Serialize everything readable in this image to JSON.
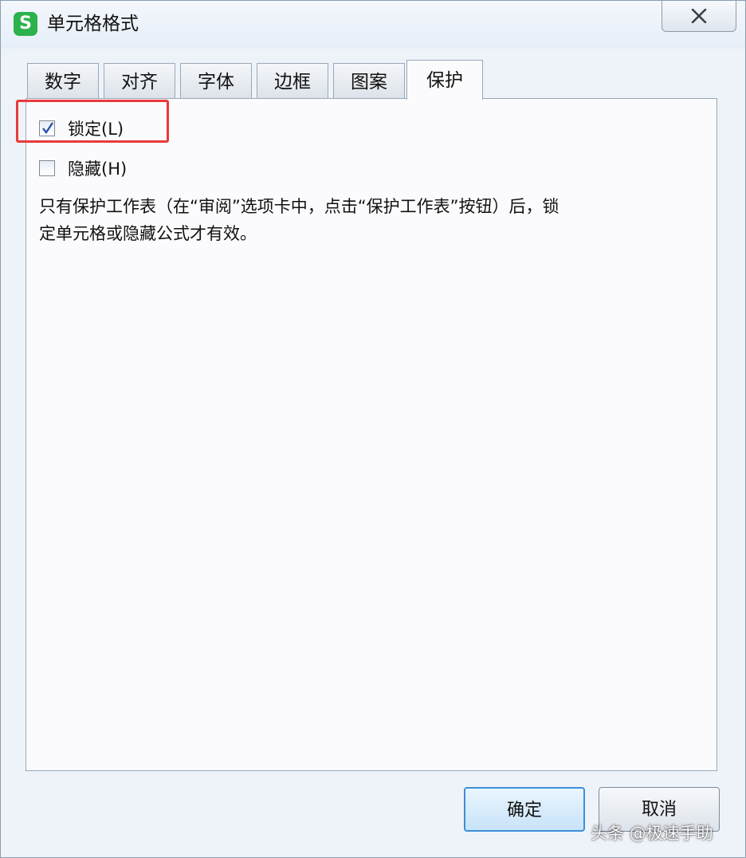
{
  "window": {
    "title": "单元格格式",
    "app_icon": "S",
    "close_icon": "close-icon"
  },
  "tabs": [
    {
      "label": "数字",
      "active": false
    },
    {
      "label": "对齐",
      "active": false
    },
    {
      "label": "字体",
      "active": false
    },
    {
      "label": "边框",
      "active": false
    },
    {
      "label": "图案",
      "active": false
    },
    {
      "label": "保护",
      "active": true
    }
  ],
  "protection": {
    "locked": {
      "label": "锁定(L)",
      "checked": true
    },
    "hidden": {
      "label": "隐藏(H)",
      "checked": false
    },
    "note_line1": "只有保护工作表（在“审阅”选项卡中，点击“保护工作表”按钮）后，锁",
    "note_line2": "定单元格或隐藏公式才有效。"
  },
  "buttons": {
    "ok": "确定",
    "cancel": "取消"
  },
  "watermark": "头条 @极速手助",
  "colors": {
    "highlight": "#e83a3a",
    "app_icon": "#2bb24c",
    "primary_border": "#3c8fd9"
  }
}
